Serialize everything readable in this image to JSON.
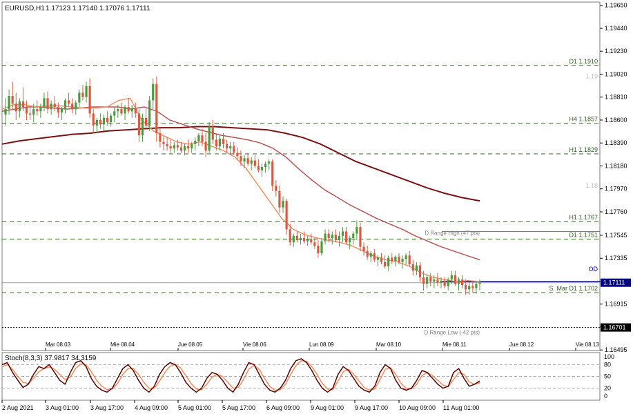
{
  "header": {
    "symbol_label": "EURUSD,H1",
    "ohlc_label": "1.17123 1.17140 1.17076 1.17111"
  },
  "stoch": {
    "label": "Stoch(8,3,3) 37.9817 34.3159",
    "levels": [
      100,
      80,
      50,
      20,
      0
    ],
    "level_labels": [
      "100",
      "80",
      "50",
      "20",
      "0"
    ],
    "main_color": "#5a0000",
    "signal_color": "#f08c5a"
  },
  "colors": {
    "bull": "#4c9a3c",
    "bear": "#d95a40",
    "ma_fast": "#f29068",
    "ma_mid": "#b85454",
    "ma_slow": "#7a1010",
    "level_line": "#2d6a1e",
    "range_line": "#d05a50",
    "price_tag": "#000080"
  },
  "chart_data": {
    "type": "candlestick",
    "symbol": "EURUSD",
    "timeframe": "H1",
    "ylim": [
      1.1649,
      1.1968
    ],
    "y_ticks": [
      1.1965,
      1.1944,
      1.1923,
      1.1902,
      1.1881,
      1.186,
      1.1839,
      1.1818,
      1.1797,
      1.1776,
      1.17545,
      1.17335,
      1.17125,
      1.16915,
      1.16705,
      1.16495
    ],
    "y_tick_labels": [
      "1.19650",
      "1.19440",
      "1.19230",
      "1.19020",
      "1.18810",
      "1.18600",
      "1.18390",
      "1.18180",
      "1.17970",
      "1.17760",
      "1.17545",
      "1.17335",
      "1.17125",
      "1.16915",
      "1.16705",
      "1.16495"
    ],
    "current_price": 1.17111,
    "current_price_label": "1.17111",
    "low_tag": 1.16701,
    "low_tag_label": "1.16701",
    "top_axis_labels": [
      "Mar 08.03",
      "Mie 08.04",
      "Jue 08.05",
      "Vie 08.06",
      "Lun 08.09",
      "Mar 08.10",
      "Mie 08.11",
      "Jue 08.12",
      "Vie 08.13"
    ],
    "bottom_axis_labels": [
      "2 Aug 2021",
      "3 Aug 01:00",
      "3 Aug 17:00",
      "4 Aug 09:00",
      "5 Aug 01:00",
      "5 Aug 17:00",
      "6 Aug 09:00",
      "9 Aug 01:00",
      "9 Aug 17:00",
      "10 Aug 09:00",
      "11 Aug 01:00"
    ],
    "levels": [
      {
        "label": "D1 1.1910",
        "price": 1.191
      },
      {
        "label": "H4 1.1857",
        "price": 1.1857
      },
      {
        "label": "H1 1.1829",
        "price": 1.1829
      },
      {
        "label": "H1 1.1767",
        "price": 1.1767
      },
      {
        "label": "D1 1.1751",
        "price": 1.1751
      },
      {
        "label": "S. Mar D1 1.1702",
        "price": 1.1702
      }
    ],
    "ranges": [
      {
        "label": "D Range High (47 pts)",
        "price": 1.1758
      },
      {
        "label": "D Range Low (-42 pts)",
        "price": 1.16701
      }
    ],
    "price_labels": [
      {
        "label": "1.19",
        "price": 1.19
      },
      {
        "label": "1.18",
        "price": 1.18
      }
    ],
    "od_label": "OD",
    "od_price": 1.1711,
    "candles": [
      [
        1.1865,
        1.188,
        1.1855,
        1.187
      ],
      [
        1.187,
        1.1888,
        1.1865,
        1.1882
      ],
      [
        1.1882,
        1.1895,
        1.187,
        1.1875
      ],
      [
        1.1875,
        1.1885,
        1.186,
        1.1868
      ],
      [
        1.1868,
        1.188,
        1.1862,
        1.1877
      ],
      [
        1.1877,
        1.189,
        1.1868,
        1.1872
      ],
      [
        1.1872,
        1.1878,
        1.186,
        1.1866
      ],
      [
        1.1866,
        1.1872,
        1.186,
        1.1865
      ],
      [
        1.1865,
        1.1875,
        1.1858,
        1.187
      ],
      [
        1.187,
        1.1878,
        1.1864,
        1.1868
      ],
      [
        1.1868,
        1.1875,
        1.1862,
        1.1872
      ],
      [
        1.1872,
        1.1885,
        1.1868,
        1.188
      ],
      [
        1.188,
        1.1886,
        1.1866,
        1.187
      ],
      [
        1.187,
        1.1878,
        1.1865,
        1.1875
      ],
      [
        1.1875,
        1.1882,
        1.1868,
        1.1872
      ],
      [
        1.1872,
        1.1876,
        1.1862,
        1.1867
      ],
      [
        1.1867,
        1.1872,
        1.186,
        1.187
      ],
      [
        1.187,
        1.188,
        1.1866,
        1.1878
      ],
      [
        1.1878,
        1.1885,
        1.1872,
        1.1875
      ],
      [
        1.1875,
        1.188,
        1.1866,
        1.187
      ],
      [
        1.187,
        1.1878,
        1.1865,
        1.1876
      ],
      [
        1.1876,
        1.1888,
        1.1872,
        1.1885
      ],
      [
        1.1885,
        1.1892,
        1.1878,
        1.1881
      ],
      [
        1.1881,
        1.1895,
        1.1876,
        1.1891
      ],
      [
        1.1891,
        1.1898,
        1.1862,
        1.1866
      ],
      [
        1.1866,
        1.187,
        1.1848,
        1.1855
      ],
      [
        1.1855,
        1.1862,
        1.1848,
        1.186
      ],
      [
        1.186,
        1.1866,
        1.1852,
        1.1856
      ],
      [
        1.1856,
        1.1865,
        1.185,
        1.1862
      ],
      [
        1.1862,
        1.1868,
        1.1855,
        1.1858
      ],
      [
        1.1858,
        1.1866,
        1.1854,
        1.1864
      ],
      [
        1.1864,
        1.1872,
        1.1858,
        1.1868
      ],
      [
        1.1868,
        1.1874,
        1.1862,
        1.187
      ],
      [
        1.187,
        1.1876,
        1.1864,
        1.1866
      ],
      [
        1.1866,
        1.1874,
        1.186,
        1.1872
      ],
      [
        1.1872,
        1.188,
        1.1866,
        1.1868
      ],
      [
        1.1868,
        1.1874,
        1.1862,
        1.1871
      ],
      [
        1.1871,
        1.1876,
        1.1862,
        1.1866
      ],
      [
        1.1866,
        1.187,
        1.184,
        1.1846
      ],
      [
        1.1846,
        1.1866,
        1.184,
        1.1862
      ],
      [
        1.1862,
        1.187,
        1.1852,
        1.1855
      ],
      [
        1.1855,
        1.1882,
        1.185,
        1.1878
      ],
      [
        1.1878,
        1.1898,
        1.187,
        1.1893
      ],
      [
        1.1893,
        1.19,
        1.184,
        1.1848
      ],
      [
        1.1848,
        1.1852,
        1.1835,
        1.184
      ],
      [
        1.184,
        1.1845,
        1.1832,
        1.1838
      ],
      [
        1.1838,
        1.1844,
        1.1832,
        1.1836
      ],
      [
        1.1836,
        1.1842,
        1.183,
        1.1834
      ],
      [
        1.1834,
        1.184,
        1.183,
        1.1837
      ],
      [
        1.1837,
        1.1842,
        1.1832,
        1.1835
      ],
      [
        1.1835,
        1.184,
        1.183,
        1.1832
      ],
      [
        1.1832,
        1.1838,
        1.1828,
        1.1836
      ],
      [
        1.1836,
        1.1842,
        1.183,
        1.1834
      ],
      [
        1.1834,
        1.184,
        1.183,
        1.1838
      ],
      [
        1.1838,
        1.1844,
        1.1832,
        1.1841
      ],
      [
        1.1841,
        1.1848,
        1.1836,
        1.1846
      ],
      [
        1.1846,
        1.1852,
        1.1836,
        1.184
      ],
      [
        1.184,
        1.1848,
        1.1826,
        1.1832
      ],
      [
        1.1832,
        1.1858,
        1.183,
        1.1854
      ],
      [
        1.1854,
        1.186,
        1.1838,
        1.1842
      ],
      [
        1.1842,
        1.1848,
        1.1832,
        1.1836
      ],
      [
        1.1836,
        1.1846,
        1.1832,
        1.1843
      ],
      [
        1.1843,
        1.1848,
        1.1834,
        1.1838
      ],
      [
        1.1838,
        1.1842,
        1.183,
        1.1834
      ],
      [
        1.1834,
        1.184,
        1.1828,
        1.1836
      ],
      [
        1.1836,
        1.184,
        1.1828,
        1.183
      ],
      [
        1.183,
        1.1835,
        1.1824,
        1.1827
      ],
      [
        1.1827,
        1.1832,
        1.1818,
        1.1822
      ],
      [
        1.1822,
        1.1828,
        1.1816,
        1.1825
      ],
      [
        1.1825,
        1.183,
        1.1818,
        1.182
      ],
      [
        1.182,
        1.1826,
        1.1814,
        1.1823
      ],
      [
        1.1823,
        1.1828,
        1.1816,
        1.1818
      ],
      [
        1.1818,
        1.1824,
        1.1812,
        1.1814
      ],
      [
        1.1814,
        1.182,
        1.1808,
        1.1817
      ],
      [
        1.1817,
        1.1822,
        1.1812,
        1.182
      ],
      [
        1.182,
        1.1824,
        1.1814,
        1.1822
      ],
      [
        1.1822,
        1.1824,
        1.1795,
        1.18
      ],
      [
        1.18,
        1.1805,
        1.179,
        1.1795
      ],
      [
        1.1795,
        1.18,
        1.1775,
        1.178
      ],
      [
        1.178,
        1.179,
        1.1775,
        1.1786
      ],
      [
        1.1786,
        1.1788,
        1.1755,
        1.176
      ],
      [
        1.176,
        1.1765,
        1.1745,
        1.1748
      ],
      [
        1.1748,
        1.1756,
        1.1744,
        1.1754
      ],
      [
        1.1754,
        1.1758,
        1.1748,
        1.175
      ],
      [
        1.175,
        1.1756,
        1.1746,
        1.1752
      ],
      [
        1.1752,
        1.1758,
        1.1747,
        1.1749
      ],
      [
        1.1749,
        1.1754,
        1.1745,
        1.1751
      ],
      [
        1.1751,
        1.1756,
        1.1746,
        1.1748
      ],
      [
        1.1748,
        1.1752,
        1.1742,
        1.1745
      ],
      [
        1.1745,
        1.175,
        1.1734,
        1.1738
      ],
      [
        1.1738,
        1.1752,
        1.1736,
        1.1749
      ],
      [
        1.1749,
        1.176,
        1.1746,
        1.1756
      ],
      [
        1.1756,
        1.176,
        1.1748,
        1.1752
      ],
      [
        1.1752,
        1.1758,
        1.1746,
        1.1755
      ],
      [
        1.1755,
        1.176,
        1.1748,
        1.175
      ],
      [
        1.175,
        1.1758,
        1.1744,
        1.1754
      ],
      [
        1.1754,
        1.1762,
        1.1748,
        1.1758
      ],
      [
        1.1758,
        1.1762,
        1.1746,
        1.1748
      ],
      [
        1.1748,
        1.1754,
        1.1742,
        1.1752
      ],
      [
        1.1752,
        1.1758,
        1.1746,
        1.1756
      ],
      [
        1.1756,
        1.1768,
        1.175,
        1.1762
      ],
      [
        1.1762,
        1.1766,
        1.174,
        1.1744
      ],
      [
        1.1744,
        1.1748,
        1.1736,
        1.174
      ],
      [
        1.174,
        1.1745,
        1.1732,
        1.1735
      ],
      [
        1.1735,
        1.174,
        1.173,
        1.1738
      ],
      [
        1.1738,
        1.1742,
        1.173,
        1.1732
      ],
      [
        1.1732,
        1.1736,
        1.1726,
        1.1734
      ],
      [
        1.1734,
        1.1738,
        1.1728,
        1.173
      ],
      [
        1.173,
        1.1736,
        1.1724,
        1.1726
      ],
      [
        1.1726,
        1.1736,
        1.1722,
        1.1734
      ],
      [
        1.1734,
        1.1738,
        1.1728,
        1.1731
      ],
      [
        1.1731,
        1.1736,
        1.1726,
        1.1735
      ],
      [
        1.1735,
        1.1738,
        1.1728,
        1.173
      ],
      [
        1.173,
        1.1736,
        1.1724,
        1.1733
      ],
      [
        1.1733,
        1.1738,
        1.1728,
        1.1736
      ],
      [
        1.1736,
        1.174,
        1.1726,
        1.1728
      ],
      [
        1.1728,
        1.1732,
        1.1718,
        1.1722
      ],
      [
        1.1722,
        1.173,
        1.1718,
        1.1727
      ],
      [
        1.1727,
        1.173,
        1.1712,
        1.1716
      ],
      [
        1.1716,
        1.1722,
        1.1704,
        1.171
      ],
      [
        1.171,
        1.1718,
        1.1706,
        1.1716
      ],
      [
        1.1716,
        1.172,
        1.1708,
        1.1712
      ],
      [
        1.1712,
        1.1718,
        1.1706,
        1.1714
      ],
      [
        1.1714,
        1.172,
        1.1708,
        1.1711
      ],
      [
        1.1711,
        1.1716,
        1.1706,
        1.1713
      ],
      [
        1.1713,
        1.1716,
        1.1706,
        1.1708
      ],
      [
        1.1708,
        1.1716,
        1.1704,
        1.1714
      ],
      [
        1.1714,
        1.1722,
        1.171,
        1.1718
      ],
      [
        1.1718,
        1.1722,
        1.1708,
        1.171
      ],
      [
        1.171,
        1.1716,
        1.1704,
        1.1714
      ],
      [
        1.1714,
        1.1718,
        1.1706,
        1.1709
      ],
      [
        1.1709,
        1.1714,
        1.17,
        1.1705
      ],
      [
        1.1705,
        1.1712,
        1.17,
        1.1708
      ],
      [
        1.1708,
        1.1713,
        1.1702,
        1.1706
      ],
      [
        1.1706,
        1.1712,
        1.1701,
        1.171
      ],
      [
        1.171,
        1.1714,
        1.1704,
        1.1712
      ]
    ],
    "ma_fast": [
      1.187,
      1.1874,
      1.1874,
      1.1872,
      1.1873,
      1.1873,
      1.1872,
      1.1871,
      1.1871,
      1.1872,
      1.1878,
      1.188,
      1.186,
      1.185,
      1.1845,
      1.184,
      1.1838,
      1.184,
      1.1836,
      1.1832,
      1.1826,
      1.1815,
      1.18,
      1.1785,
      1.177,
      1.176,
      1.1755,
      1.1752,
      1.175,
      1.1748,
      1.1745,
      1.174,
      1.1735,
      1.1732,
      1.173,
      1.1726,
      1.172,
      1.1716,
      1.1714,
      1.1712,
      1.1713,
      1.1712
    ],
    "ma_mid": [
      1.1868,
      1.187,
      1.1872,
      1.1872,
      1.1871,
      1.187,
      1.1871,
      1.1872,
      1.1872,
      1.1872,
      1.187,
      1.1872,
      1.1868,
      1.186,
      1.1856,
      1.1852,
      1.1849,
      1.1846,
      1.1844,
      1.1842,
      1.1839,
      1.1834,
      1.1826,
      1.1815,
      1.1805,
      1.1796,
      1.1789,
      1.1782,
      1.1776,
      1.177,
      1.1765,
      1.176,
      1.1754,
      1.1749,
      1.1744,
      1.174,
      1.1736,
      1.1732
    ],
    "ma_slow": [
      1.1838,
      1.1841,
      1.1843,
      1.1845,
      1.1847,
      1.1848,
      1.185,
      1.1851,
      1.1852,
      1.1853,
      1.1853,
      1.1854,
      1.1854,
      1.1853,
      1.1852,
      1.1851,
      1.1848,
      1.1844,
      1.1838,
      1.183,
      1.1822,
      1.1816,
      1.181,
      1.1804,
      1.1798,
      1.1793,
      1.1789,
      1.1786
    ],
    "stoch_main": [
      80,
      85,
      60,
      40,
      22,
      30,
      55,
      75,
      70,
      80,
      60,
      40,
      30,
      60,
      85,
      90,
      75,
      45,
      25,
      15,
      10,
      20,
      45,
      70,
      80,
      65,
      40,
      20,
      10,
      25,
      55,
      75,
      85,
      80,
      60,
      35,
      20,
      10,
      20,
      45,
      60,
      55,
      40,
      20,
      10,
      30,
      60,
      85,
      80,
      55,
      30,
      15,
      10,
      20,
      40,
      70,
      90,
      95,
      85,
      65,
      40,
      20,
      10,
      20,
      55,
      75,
      65,
      45,
      25,
      15,
      10,
      25,
      60,
      80,
      70,
      40,
      20,
      15,
      20,
      40,
      65,
      60,
      45,
      30,
      20,
      25,
      60,
      70,
      45,
      25,
      30,
      38
    ],
    "stoch_signal": [
      75,
      80,
      68,
      50,
      35,
      32,
      45,
      62,
      70,
      74,
      68,
      55,
      42,
      48,
      70,
      82,
      80,
      62,
      40,
      25,
      16,
      18,
      32,
      55,
      70,
      70,
      55,
      35,
      20,
      20,
      38,
      60,
      76,
      80,
      72,
      52,
      32,
      18,
      16,
      30,
      48,
      55,
      50,
      35,
      20,
      22,
      42,
      68,
      78,
      68,
      45,
      25,
      15,
      16,
      30,
      55,
      78,
      90,
      88,
      75,
      55,
      32,
      18,
      16,
      38,
      62,
      68,
      55,
      38,
      22,
      15,
      18,
      42,
      68,
      72,
      55,
      32,
      20,
      18,
      30,
      52,
      60,
      52,
      40,
      28,
      24,
      42,
      60,
      55,
      36,
      30,
      34
    ]
  }
}
